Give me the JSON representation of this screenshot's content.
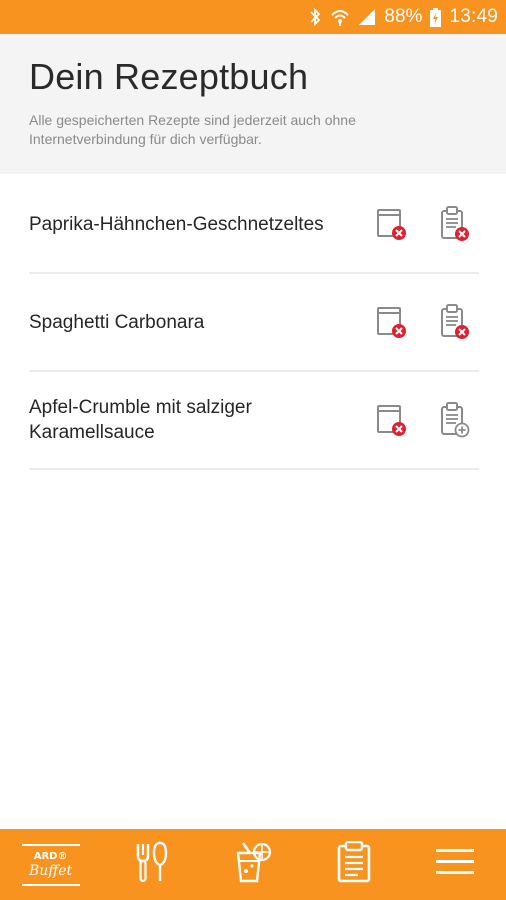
{
  "status_bar": {
    "battery_percent": "88%",
    "time": "13:49"
  },
  "header": {
    "title": "Dein Rezeptbuch",
    "subtitle": "Alle gespeicherten Rezepte sind jederzeit auch ohne Internetverbindung für dich verfügbar."
  },
  "recipes": [
    {
      "title": "Paprika-Hähnchen-Geschnetzeltes",
      "book_icon": "remove-from-book-icon",
      "list_icon": "remove-from-shopping-list-icon"
    },
    {
      "title": "Spaghetti Carbonara",
      "book_icon": "remove-from-book-icon",
      "list_icon": "remove-from-shopping-list-icon"
    },
    {
      "title": "Apfel-Crumble mit salziger Karamellsauce",
      "book_icon": "remove-from-book-icon",
      "list_icon": "add-to-shopping-list-icon"
    }
  ],
  "bottom_nav": {
    "logo_top": "ARD®",
    "logo_bottom": "Buffet",
    "items": [
      "logo",
      "cutlery-icon",
      "drink-icon",
      "clipboard-icon",
      "menu-icon"
    ]
  },
  "colors": {
    "brand_orange": "#f7931e",
    "remove_red": "#e0202f",
    "header_bg": "#f4f4f4"
  }
}
